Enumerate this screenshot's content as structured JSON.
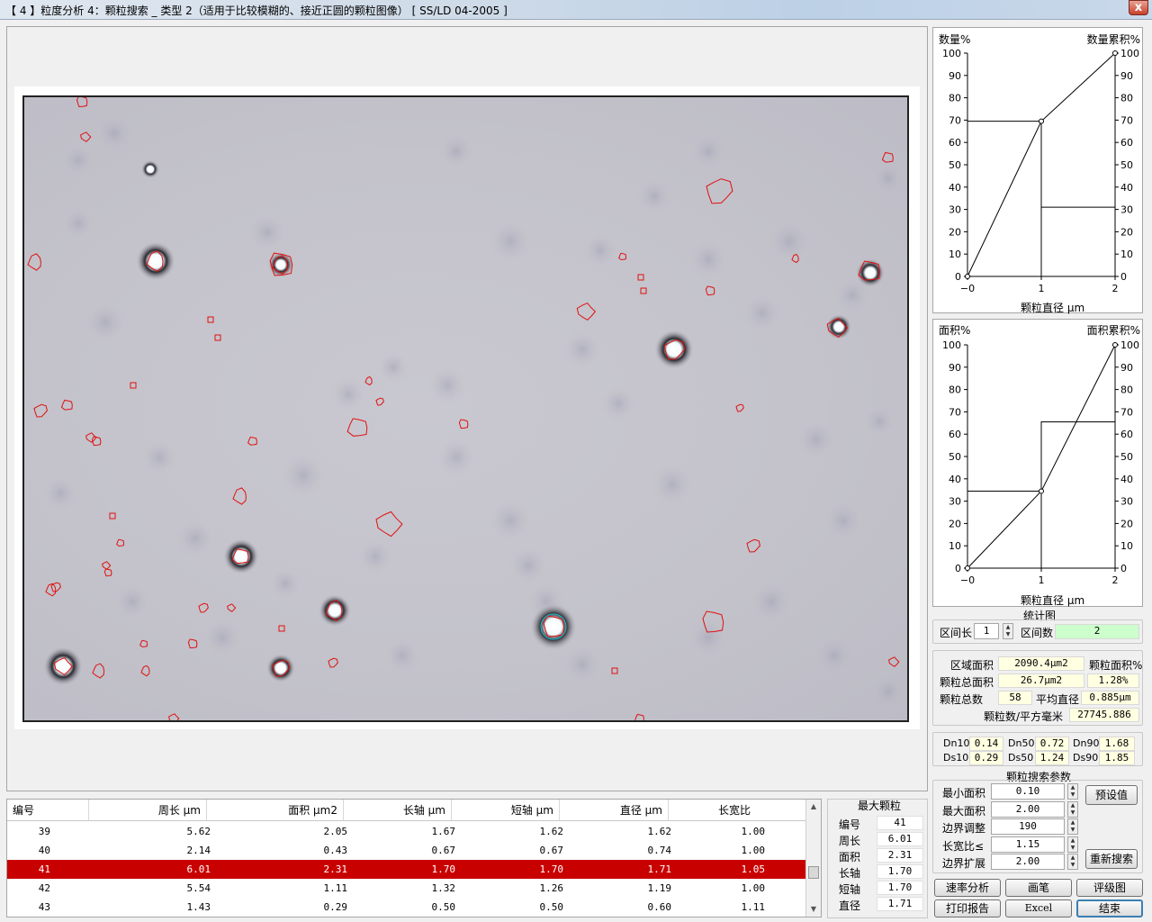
{
  "window": {
    "title": "【 4 】粒度分析 4：颗粒搜索 _ 类型 2（适用于比较模糊的、接近正圆的颗粒图像） [    SS/LD 04-2005    ]",
    "close_glyph": "x"
  },
  "charts_panel": {
    "chart_count": {
      "left_title": "数量%",
      "right_title": "数量累积%",
      "y_ticks": [
        "100",
        "90",
        "80",
        "70",
        "60",
        "50",
        "40",
        "30",
        "20",
        "10",
        "0"
      ],
      "x_ticks": [
        "−0",
        "1",
        "2"
      ],
      "xlabel": "颗粒直径 μm"
    },
    "chart_area": {
      "left_title": "面积%",
      "right_title": "面积累积%",
      "y_ticks": [
        "100",
        "90",
        "80",
        "70",
        "60",
        "50",
        "40",
        "30",
        "20",
        "10",
        "0"
      ],
      "x_ticks": [
        "−0",
        "1",
        "2"
      ],
      "xlabel": "颗粒直径 μm"
    },
    "stat_title": "统计图",
    "interval_len_label": "区间长",
    "interval_len_value": "1",
    "interval_count_label": "区间数",
    "interval_count_value": "2"
  },
  "chart_data": [
    {
      "type": "bar",
      "name": "count",
      "categories": [
        "0-1",
        "1-2"
      ],
      "series": [
        {
          "values": [
            69.5,
            31.0
          ]
        }
      ],
      "cumulative": [
        [
          0,
          0
        ],
        [
          1,
          69.5
        ],
        [
          2,
          100
        ]
      ],
      "ylim": [
        0,
        100
      ],
      "xlim": [
        0,
        2
      ]
    },
    {
      "type": "bar",
      "name": "area",
      "categories": [
        "0-1",
        "1-2"
      ],
      "series": [
        {
          "values": [
            34.5,
            65.5
          ]
        }
      ],
      "cumulative": [
        [
          0,
          0
        ],
        [
          1,
          34.5
        ],
        [
          2,
          100
        ]
      ],
      "ylim": [
        0,
        100
      ],
      "xlim": [
        0,
        2
      ]
    }
  ],
  "stats": {
    "region_area_label": "区域面积",
    "region_area_value": "2090.4μm2",
    "particle_area_pct_label": "颗粒面积%",
    "total_area_label": "颗粒总面积",
    "total_area_value": "26.7μm2",
    "area_pct_value": "1.28%",
    "total_count_label": "颗粒总数",
    "total_count_value": "58",
    "mean_diam_label": "平均直径",
    "mean_diam_value": "0.885μm",
    "density_label": "颗粒数/平方毫米",
    "density_value": "27745.886"
  },
  "dvalues": {
    "dn10_label": "Dn10",
    "dn10": "0.14",
    "dn50_label": "Dn50",
    "dn50": "0.72",
    "dn90_label": "Dn90",
    "dn90": "1.68",
    "ds10_label": "Ds10",
    "ds10": "0.29",
    "ds50_label": "Ds50",
    "ds50": "1.24",
    "ds90_label": "Ds90",
    "ds90": "1.85"
  },
  "search_params": {
    "title": "颗粒搜索参数",
    "min_area_label": "最小面积",
    "min_area": "0.10",
    "max_area_label": "最大面积",
    "max_area": "2.00",
    "edge_adjust_label": "边界调整",
    "edge_adjust": "190",
    "aspect_label": "长宽比≤",
    "aspect": "1.15",
    "edge_expand_label": "边界扩展",
    "edge_expand": "2.00",
    "preset_button": "预设值",
    "research_button": "重新搜索"
  },
  "buttons": {
    "rate": "速率分析",
    "pen": "画笔",
    "grade": "评级图",
    "print": "打印报告",
    "excel": "Excel",
    "finish": "结束"
  },
  "table": {
    "headers": [
      "编号",
      "周长 μm",
      "面积 μm2",
      "长轴 μm",
      "短轴 μm",
      "直径 μm",
      "长宽比"
    ],
    "rows": [
      [
        "39",
        "5.62",
        "2.05",
        "1.67",
        "1.62",
        "1.62",
        "1.00"
      ],
      [
        "40",
        "2.14",
        "0.43",
        "0.67",
        "0.67",
        "0.74",
        "1.00"
      ],
      [
        "41",
        "6.01",
        "2.31",
        "1.70",
        "1.70",
        "1.71",
        "1.05"
      ],
      [
        "42",
        "5.54",
        "1.11",
        "1.32",
        "1.26",
        "1.19",
        "1.00"
      ],
      [
        "43",
        "1.43",
        "0.29",
        "0.50",
        "0.50",
        "0.60",
        "1.11"
      ]
    ],
    "selected_row": 2
  },
  "max_particle": {
    "title": "最大颗粒",
    "id_label": "编号",
    "id": "41",
    "perimeter_label": "周长",
    "perimeter": "6.01",
    "area_label": "面积",
    "area": "2.31",
    "major_label": "长轴",
    "major": "1.70",
    "minor_label": "短轴",
    "minor": "1.70",
    "diam_label": "直径",
    "diam": "1.71"
  }
}
